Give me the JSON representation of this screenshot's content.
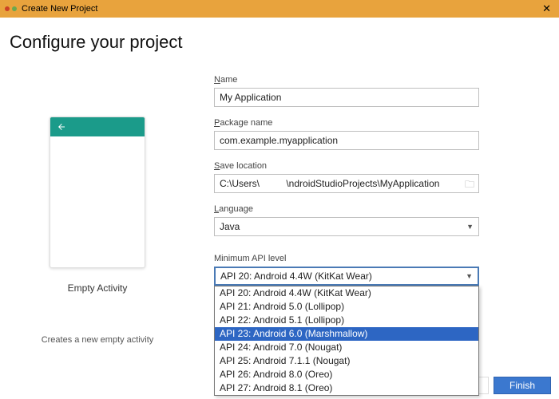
{
  "window": {
    "title": "Create New Project"
  },
  "heading": "Configure your project",
  "preview": {
    "template_name": "Empty Activity",
    "description": "Creates a new empty activity"
  },
  "fields": {
    "name": {
      "label": "Name",
      "value": "My Application"
    },
    "package": {
      "label": "Package name",
      "value": "com.example.myapplication"
    },
    "save": {
      "label": "Save location",
      "value": "C:\\Users\\          \\ndroidStudioProjects\\MyApplication"
    },
    "language": {
      "label": "Language",
      "value": "Java"
    },
    "api": {
      "label": "Minimum API level",
      "value": "API 20: Android 4.4W (KitKat Wear)"
    }
  },
  "api_options": [
    "API 20: Android 4.4W (KitKat Wear)",
    "API 21: Android 5.0 (Lollipop)",
    "API 22: Android 5.1 (Lollipop)",
    "API 23: Android 6.0 (Marshmallow)",
    "API 24: Android 7.0 (Nougat)",
    "API 25: Android 7.1.1 (Nougat)",
    "API 26: Android 8.0 (Oreo)",
    "API 27: Android 8.1 (Oreo)"
  ],
  "api_highlight_index": 3,
  "footer": {
    "finish": "Finish"
  }
}
